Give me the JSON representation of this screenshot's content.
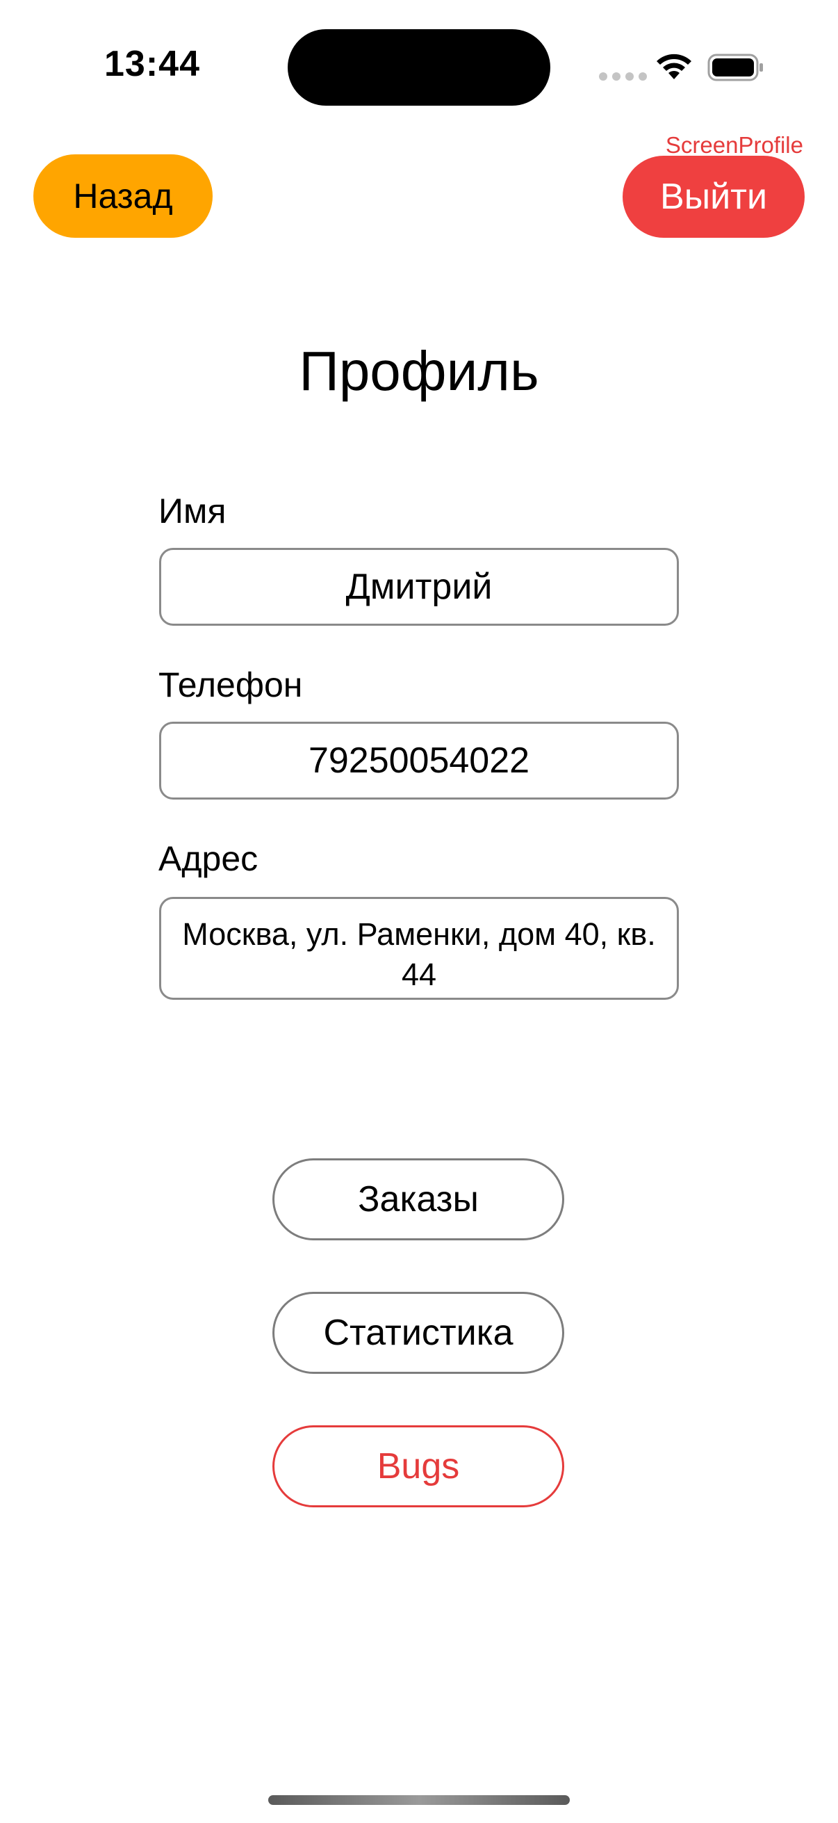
{
  "status_bar": {
    "time": "13:44",
    "icons": [
      "cellular-signal-icon",
      "wifi-icon",
      "battery-icon"
    ]
  },
  "top_bar": {
    "screen_label": "ScreenProfile",
    "back_label": "Назад",
    "logout_label": "Выйти"
  },
  "page": {
    "title": "Профиль"
  },
  "form": {
    "name": {
      "label": "Имя",
      "value": "Дмитрий"
    },
    "phone": {
      "label": "Телефон",
      "value": "79250054022"
    },
    "address": {
      "label": "Адрес",
      "value": "Москва, ул. Раменки, дом 40, кв. 44"
    }
  },
  "actions": {
    "orders_label": "Заказы",
    "statistics_label": "Статистика",
    "bugs_label": "Bugs"
  },
  "colors": {
    "back_button": "#ffa500",
    "logout_button": "#ef4040",
    "accent_red": "#e53b3b",
    "border_gray": "#8a8a8a"
  }
}
